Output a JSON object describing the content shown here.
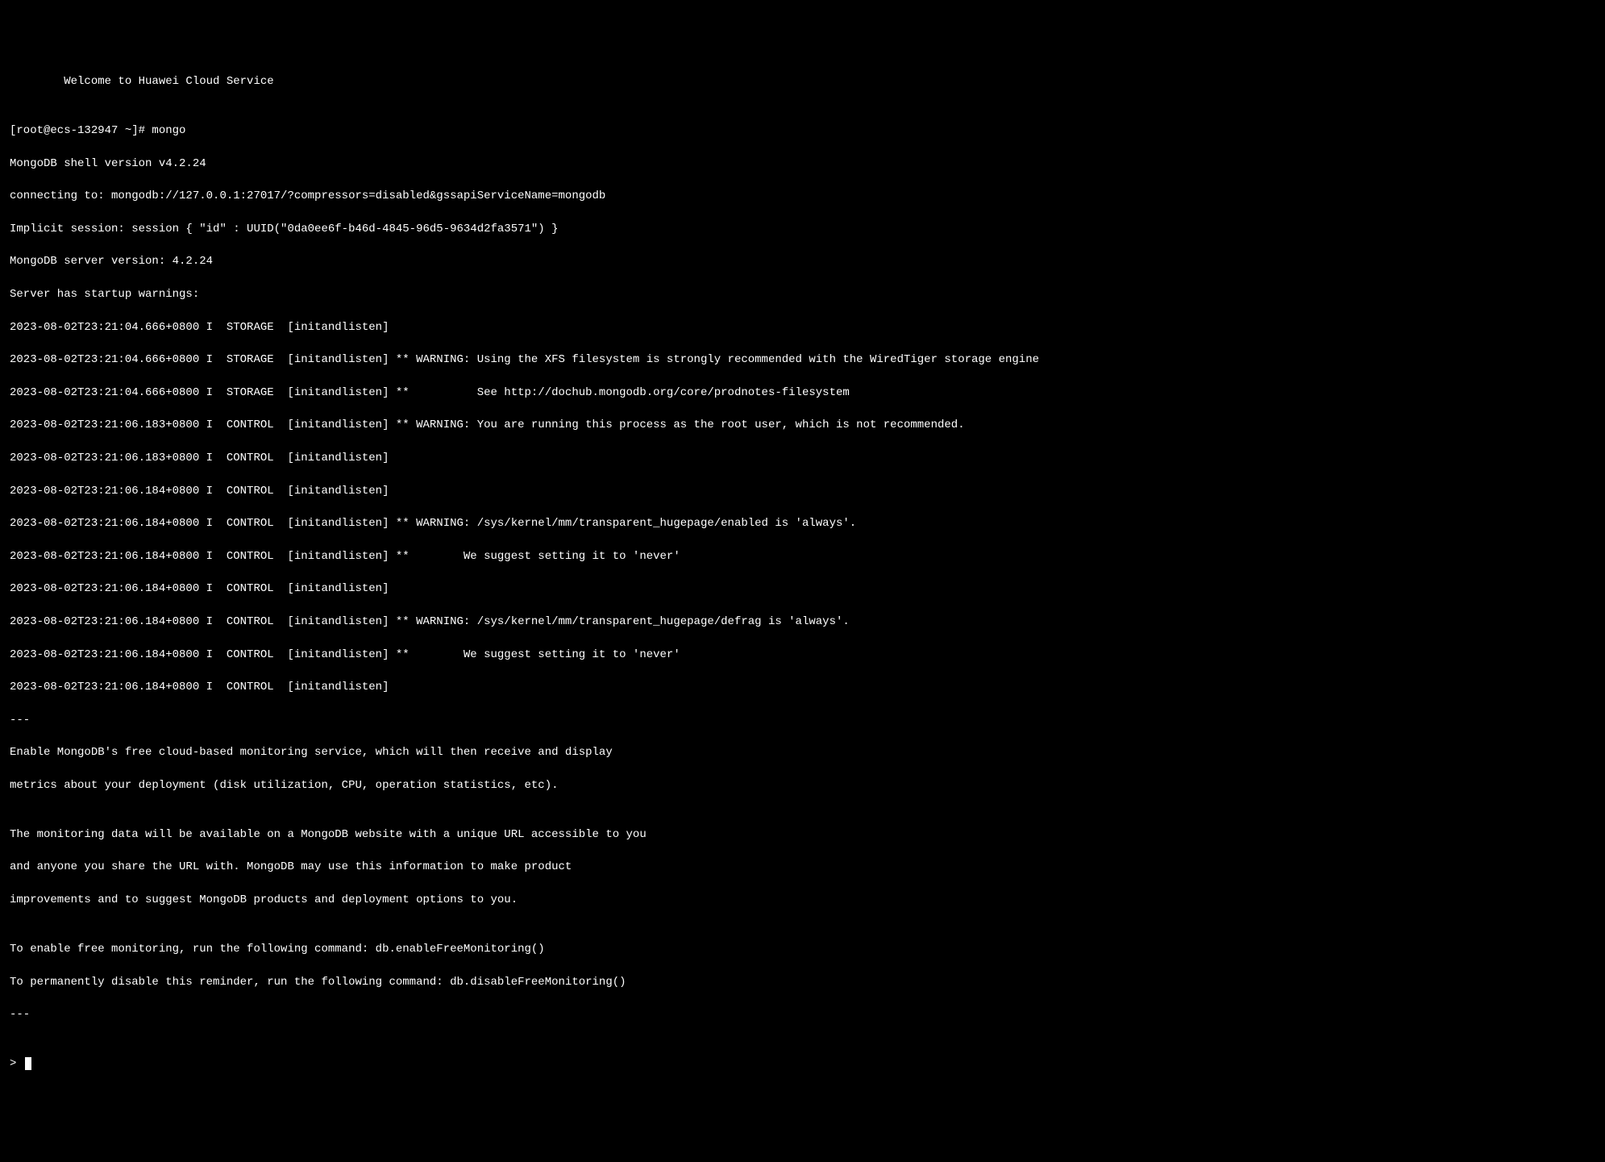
{
  "terminal": {
    "welcome": "        Welcome to Huawei Cloud Service",
    "blank": "",
    "prompt_cmd": "[root@ecs-132947 ~]# mongo",
    "shell_version": "MongoDB shell version v4.2.24",
    "connecting": "connecting to: mongodb://127.0.0.1:27017/?compressors=disabled&gssapiServiceName=mongodb",
    "session": "Implicit session: session { \"id\" : UUID(\"0da0ee6f-b46d-4845-96d5-9634d2fa3571\") }",
    "server_version": "MongoDB server version: 4.2.24",
    "startup_warnings": "Server has startup warnings:",
    "w1": "2023-08-02T23:21:04.666+0800 I  STORAGE  [initandlisten]",
    "w2": "2023-08-02T23:21:04.666+0800 I  STORAGE  [initandlisten] ** WARNING: Using the XFS filesystem is strongly recommended with the WiredTiger storage engine",
    "w3": "2023-08-02T23:21:04.666+0800 I  STORAGE  [initandlisten] **          See http://dochub.mongodb.org/core/prodnotes-filesystem",
    "w4": "2023-08-02T23:21:06.183+0800 I  CONTROL  [initandlisten] ** WARNING: You are running this process as the root user, which is not recommended.",
    "w5": "2023-08-02T23:21:06.183+0800 I  CONTROL  [initandlisten]",
    "w6": "2023-08-02T23:21:06.184+0800 I  CONTROL  [initandlisten]",
    "w7": "2023-08-02T23:21:06.184+0800 I  CONTROL  [initandlisten] ** WARNING: /sys/kernel/mm/transparent_hugepage/enabled is 'always'.",
    "w8": "2023-08-02T23:21:06.184+0800 I  CONTROL  [initandlisten] **        We suggest setting it to 'never'",
    "w9": "2023-08-02T23:21:06.184+0800 I  CONTROL  [initandlisten]",
    "w10": "2023-08-02T23:21:06.184+0800 I  CONTROL  [initandlisten] ** WARNING: /sys/kernel/mm/transparent_hugepage/defrag is 'always'.",
    "w11": "2023-08-02T23:21:06.184+0800 I  CONTROL  [initandlisten] **        We suggest setting it to 'never'",
    "w12": "2023-08-02T23:21:06.184+0800 I  CONTROL  [initandlisten]",
    "dashes1": "---",
    "monitor1": "Enable MongoDB's free cloud-based monitoring service, which will then receive and display",
    "monitor2": "metrics about your deployment (disk utilization, CPU, operation statistics, etc).",
    "monitor3": "The monitoring data will be available on a MongoDB website with a unique URL accessible to you",
    "monitor4": "and anyone you share the URL with. MongoDB may use this information to make product",
    "monitor5": "improvements and to suggest MongoDB products and deployment options to you.",
    "enable": "To enable free monitoring, run the following command: db.enableFreeMonitoring()",
    "disable": "To permanently disable this reminder, run the following command: db.disableFreeMonitoring()",
    "dashes2": "---",
    "shell_prompt": "> "
  }
}
